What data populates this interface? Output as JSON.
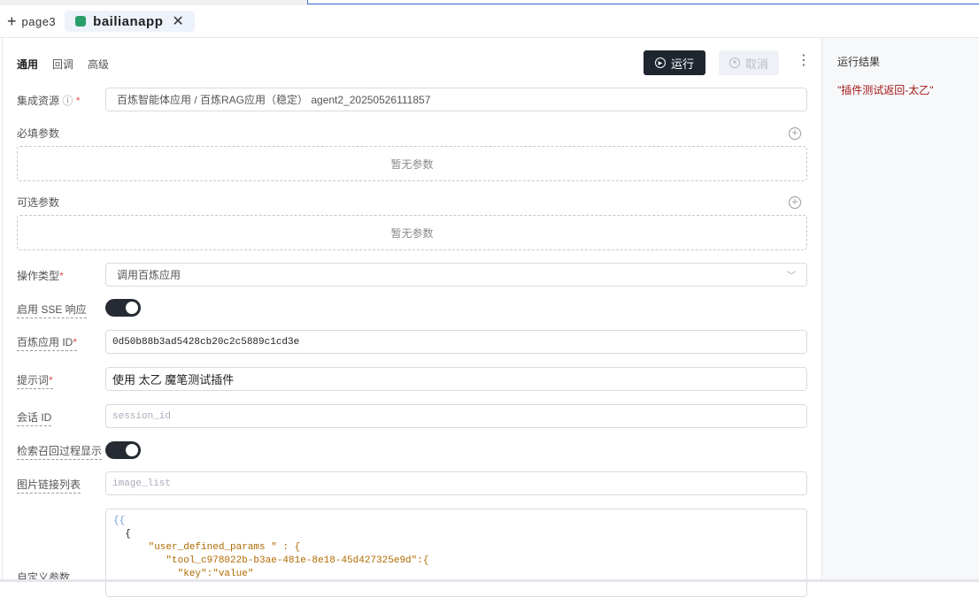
{
  "tabbar": {
    "add_label": "+",
    "page_tab": "page3",
    "active_tab": "bailianapp",
    "close": "✕"
  },
  "subtabs": [
    "通用",
    "回调",
    "高级"
  ],
  "toolbar": {
    "run": "运行",
    "cancel": "取消",
    "more": "⋮"
  },
  "form": {
    "resource_label": "集成资源",
    "resource_value": "百炼智能体应用 / 百炼RAG应用（稳定） agent2_20250526111857",
    "required_params_label": "必填参数",
    "required_empty": "暂无参数",
    "optional_params_label": "可选参数",
    "optional_empty": "暂无参数",
    "op_type_label": "操作类型",
    "op_type_value": "调用百炼应用",
    "sse_label": "启用 SSE 响应",
    "sse_on": true,
    "app_id_label": "百炼应用 ID",
    "app_id_value": "0d50b88b3ad5428cb20c2c5889c1cd3e",
    "prompt_label": "提示词",
    "prompt_value": "使用 太乙 魔笔测试插件",
    "session_label": "会话 ID",
    "session_placeholder": "session_id",
    "retrieval_label": "检索召回过程显示",
    "retrieval_on": true,
    "images_label": "图片链接列表",
    "images_placeholder": "image_list",
    "custom_label": "自定义参数",
    "custom_lines": [
      "{{",
      "  {",
      "      \"user_defined_params \" : {",
      "         \"tool_c978022b-b3ae-481e-8e18-45d427325e9d\":{",
      "           \"key\":\"value\""
    ]
  },
  "result": {
    "title": "运行结果",
    "value": "\"插件测试返回-太乙\""
  }
}
